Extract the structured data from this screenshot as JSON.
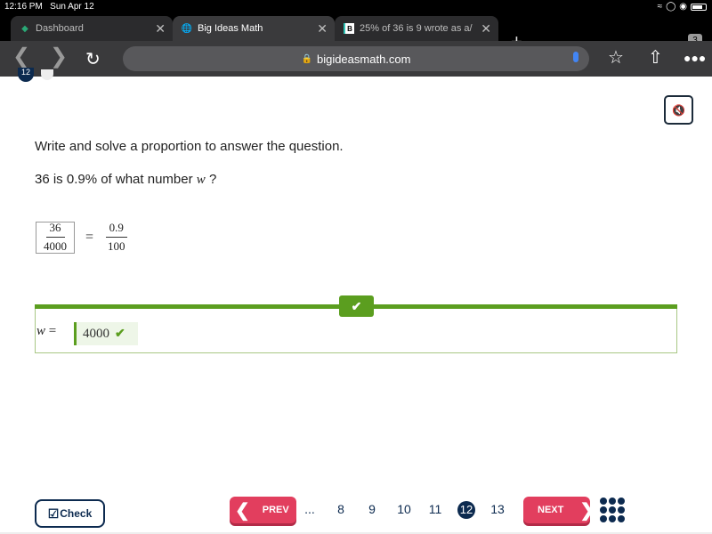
{
  "status_bar": {
    "time": "12:16 PM",
    "date": "Sun Apr 12"
  },
  "browser": {
    "tabs": [
      {
        "title": "Dashboard",
        "icon": "layers-icon",
        "active": false
      },
      {
        "title": "Big Ideas Math",
        "icon": "globe-icon",
        "active": true
      },
      {
        "title": "25% of 36 is 9 wrote as a/",
        "icon": "brainly-icon",
        "active": false
      }
    ],
    "tab_count": "3",
    "url": "bigideasmath.com"
  },
  "page": {
    "question_number": "12",
    "instruction": "Write and solve a proportion to answer the question.",
    "question_prefix": "36 is 0.9% of what number ",
    "question_var": "w",
    "question_suffix": " ?",
    "proportion": {
      "left_num": "36",
      "left_den": "4000",
      "equals": "=",
      "right_num": "0.9",
      "right_den": "100"
    },
    "answer": {
      "label_var": "w",
      "label_eq": " =",
      "value": "4000",
      "status": "correct",
      "accent": "#5b9e1f"
    }
  },
  "footer": {
    "check_label": "Check",
    "prev_label": "PREV",
    "next_label": "NEXT",
    "ellipsis": "...",
    "pages": [
      "8",
      "9",
      "10",
      "11",
      "12",
      "13"
    ],
    "current_page": "12",
    "accent_color": "#e23e5e",
    "navy": "#0c2a4f"
  }
}
